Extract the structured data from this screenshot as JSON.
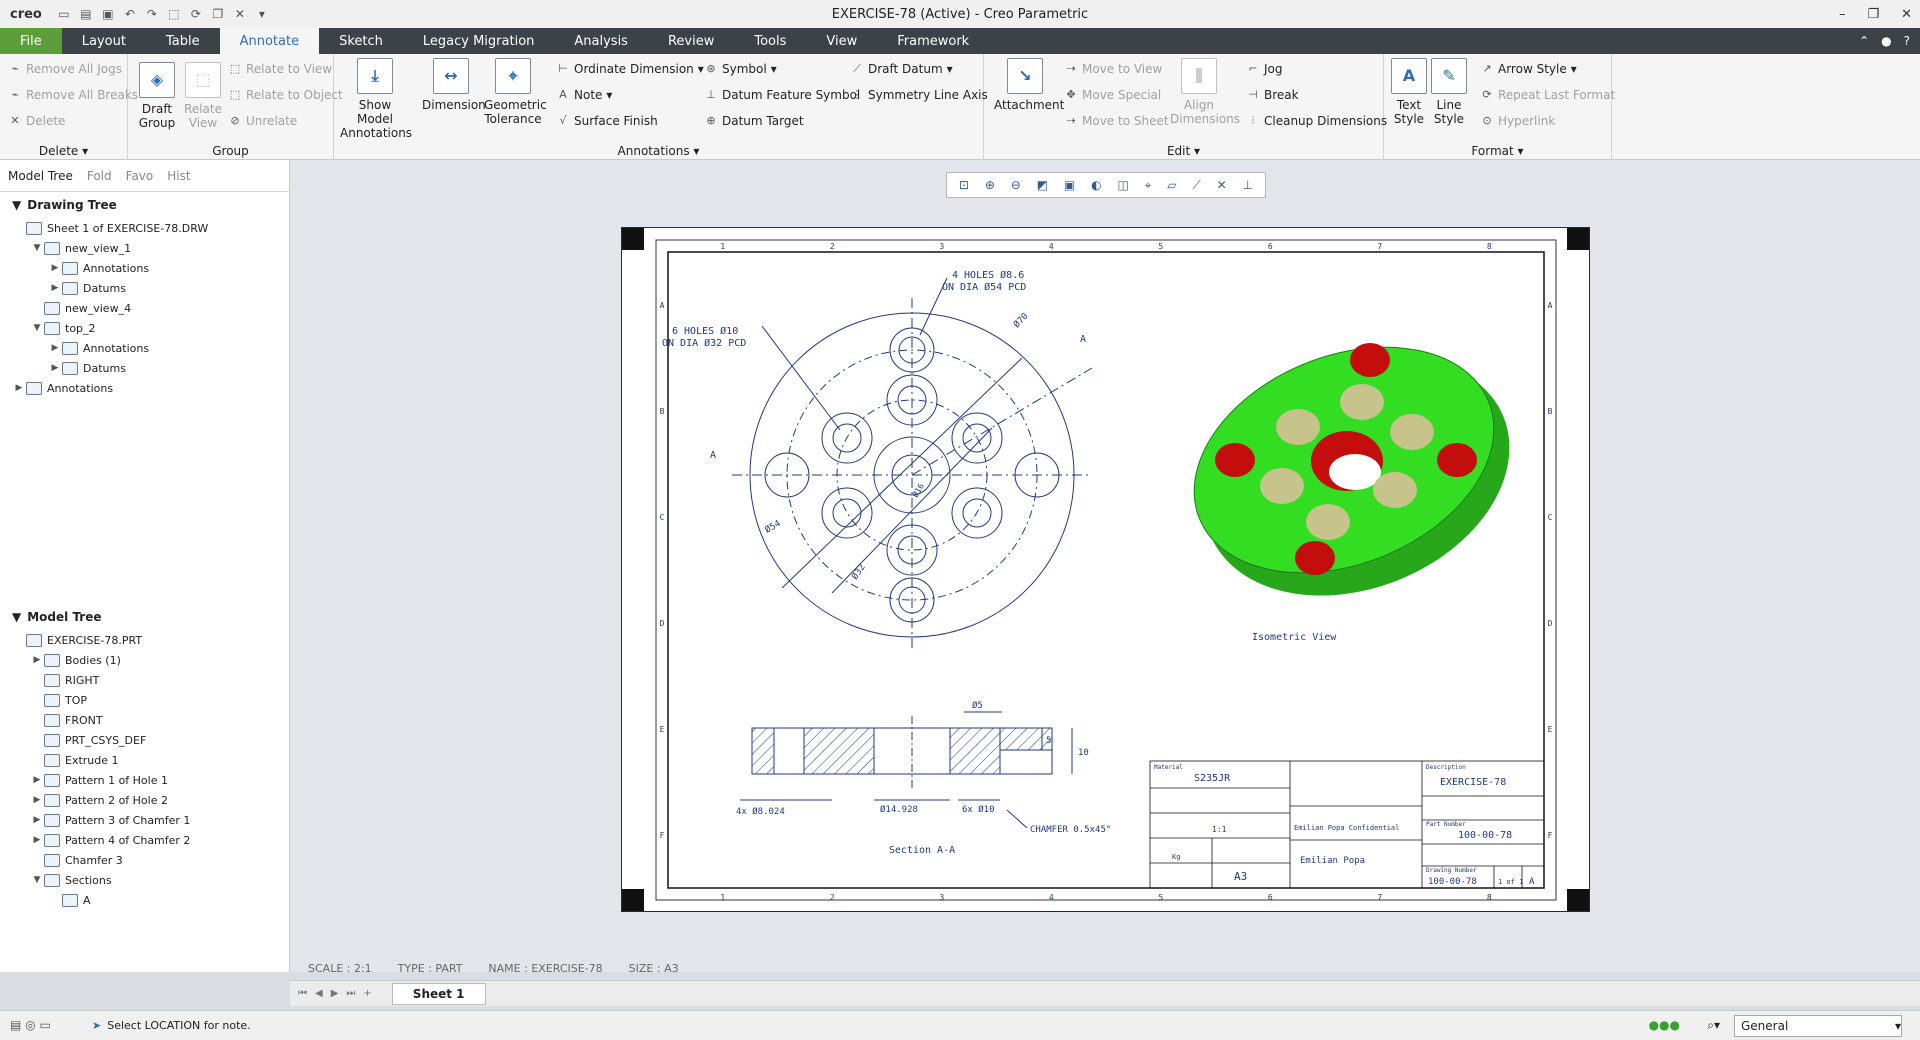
{
  "window": {
    "app": "creo",
    "title": "EXERCISE-78 (Active) - Creo Parametric"
  },
  "menu": {
    "file": "File",
    "tabs": [
      "Layout",
      "Table",
      "Annotate",
      "Sketch",
      "Legacy Migration",
      "Analysis",
      "Review",
      "Tools",
      "View",
      "Framework"
    ],
    "active": "Annotate"
  },
  "ribbon": {
    "delete": {
      "items": [
        "Remove All Jogs",
        "Remove All Breaks",
        "Delete"
      ],
      "title": "Delete"
    },
    "group": {
      "draft_group": "Draft Group",
      "relate_view": "Relate View",
      "items": [
        "Relate to View",
        "Relate to Object",
        "Unrelate"
      ],
      "title": "Group"
    },
    "annotations": {
      "show_model": "Show Model Annotations",
      "dimension": "Dimension",
      "geometric_tolerance": "Geometric Tolerance",
      "col1": [
        "Ordinate Dimension",
        "Note",
        "Surface Finish"
      ],
      "col2": [
        "Symbol",
        "Datum Feature Symbol",
        "Datum Target"
      ],
      "col3": [
        "Draft Datum",
        "Symmetry Line Axis"
      ],
      "title": "Annotations"
    },
    "edit": {
      "attachment": "Attachment",
      "moves": [
        "Move to View",
        "Move Special",
        "Move to Sheet"
      ],
      "align": "Align Dimensions",
      "items": [
        "Jog",
        "Break",
        "Cleanup Dimensions"
      ],
      "title": "Edit"
    },
    "format": {
      "text_style": "Text Style",
      "line_style": "Line Style",
      "items": [
        "Arrow Style",
        "Repeat Last Format",
        "Hyperlink"
      ],
      "title": "Format"
    }
  },
  "left_panel": {
    "tabs": [
      "Model Tree",
      "Fold",
      "Favo",
      "Hist"
    ],
    "drawing_tree_title": "Drawing Tree",
    "drawing_tree": [
      {
        "label": "Sheet 1 of EXERCISE-78.DRW",
        "level": 0,
        "tw": ""
      },
      {
        "label": "new_view_1",
        "level": 1,
        "tw": "▼"
      },
      {
        "label": "Annotations",
        "level": 2,
        "tw": "▶"
      },
      {
        "label": "Datums",
        "level": 2,
        "tw": "▶"
      },
      {
        "label": "new_view_4",
        "level": 1,
        "tw": ""
      },
      {
        "label": "top_2",
        "level": 1,
        "tw": "▼"
      },
      {
        "label": "Annotations",
        "level": 2,
        "tw": "▶"
      },
      {
        "label": "Datums",
        "level": 2,
        "tw": "▶"
      },
      {
        "label": "Annotations",
        "level": 0,
        "tw": "▶"
      }
    ],
    "model_tree_title": "Model Tree",
    "model_tree": [
      {
        "label": "EXERCISE-78.PRT",
        "level": 0,
        "tw": ""
      },
      {
        "label": "Bodies (1)",
        "level": 1,
        "tw": "▶"
      },
      {
        "label": "RIGHT",
        "level": 1,
        "tw": ""
      },
      {
        "label": "TOP",
        "level": 1,
        "tw": ""
      },
      {
        "label": "FRONT",
        "level": 1,
        "tw": ""
      },
      {
        "label": "PRT_CSYS_DEF",
        "level": 1,
        "tw": ""
      },
      {
        "label": "Extrude 1",
        "level": 1,
        "tw": ""
      },
      {
        "label": "Pattern 1 of Hole 1",
        "level": 1,
        "tw": "▶"
      },
      {
        "label": "Pattern 2 of Hole 2",
        "level": 1,
        "tw": "▶"
      },
      {
        "label": "Pattern 3 of Chamfer 1",
        "level": 1,
        "tw": "▶"
      },
      {
        "label": "Pattern 4 of Chamfer 2",
        "level": 1,
        "tw": "▶"
      },
      {
        "label": "Chamfer 3",
        "level": 1,
        "tw": ""
      },
      {
        "label": "Sections",
        "level": 1,
        "tw": "▼"
      },
      {
        "label": "A",
        "level": 2,
        "tw": ""
      }
    ]
  },
  "drawing": {
    "note1": "6 HOLES Ø10",
    "note1b": "ON DIA Ø32 PCD",
    "note2": "4 HOLES Ø8.6",
    "note2b": "ON DIA Ø54 PCD",
    "dim_70": "Ø70",
    "dim_54": "Ø54",
    "dim_32": "Ø32",
    "dim_16": "Ø16",
    "section_label_a": "A",
    "iso_label": "Isometric View",
    "section_label": "Section A-A",
    "dim_5": "Ø5",
    "dim_10": "10",
    "dim_5b": "5",
    "dim_holes": "4x Ø8.024",
    "dim_14": "Ø14.928",
    "dim_6x": "6x Ø10",
    "chamfer": "CHAMFER 0.5x45°",
    "zone_cols": [
      "1",
      "2",
      "3",
      "4",
      "5",
      "6",
      "7",
      "8"
    ],
    "zone_rows": [
      "A",
      "B",
      "C",
      "D",
      "E",
      "F"
    ],
    "title_block": {
      "material_label": "Material",
      "material": "S235JR",
      "description_label": "Description",
      "description": "EXERCISE-78",
      "confidential": "Emilian Popa Confidential",
      "owner": "Emilian Popa",
      "part_number_label": "Part Number",
      "part_number": "100-00-78",
      "drawing_number_label": "Drawing Number",
      "drawing_number": "100-00-78",
      "sheet_size": "A3",
      "sheet": "1 of 1",
      "revision": "A",
      "scale": "1:1",
      "weight": "Kg"
    }
  },
  "status_info": [
    "SCALE : 2:1",
    "TYPE : PART",
    "NAME : EXERCISE-78",
    "SIZE : A3"
  ],
  "sheet_tab": "Sheet 1",
  "status_message": "Select LOCATION for note.",
  "filter": "General",
  "colors": {
    "menubar": "#3c4248",
    "file_tab": "#5b9e3a",
    "accent": "#2c6fb5",
    "part_green": "#33dd22",
    "hole_red": "#c40d0d"
  }
}
